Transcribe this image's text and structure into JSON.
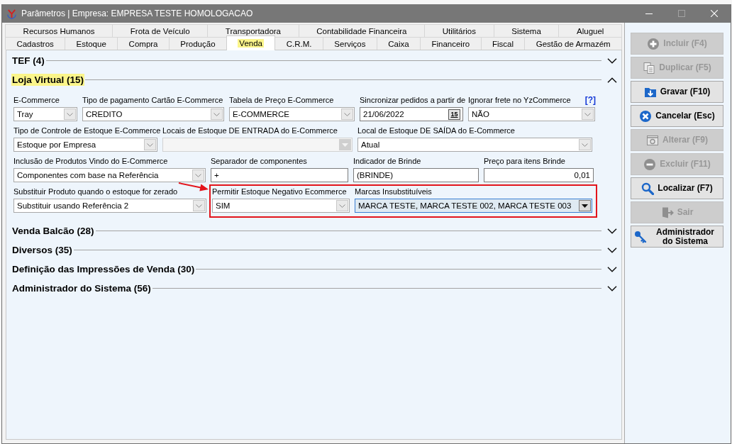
{
  "window": {
    "title": "Parâmetros | Empresa: EMPRESA TESTE HOMOLOGACAO"
  },
  "window_controls": [
    {
      "kind": "minimize",
      "disabled": false
    },
    {
      "kind": "maximize",
      "disabled": true
    },
    {
      "kind": "close",
      "disabled": false
    }
  ],
  "tab_rows": [
    [
      {
        "label": "Recursos Humanos",
        "selected": false,
        "highlighted": false
      },
      {
        "label": "Frota de Veículo",
        "selected": false,
        "highlighted": false
      },
      {
        "label": "Transportadora",
        "selected": false,
        "highlighted": false
      },
      {
        "label": "Contabilidade Financeira",
        "selected": false,
        "highlighted": false
      },
      {
        "label": "Utilitários",
        "selected": false,
        "highlighted": false
      },
      {
        "label": "Sistema",
        "selected": false,
        "highlighted": false
      },
      {
        "label": "Aluguel",
        "selected": false,
        "highlighted": false
      }
    ],
    [
      {
        "label": "Cadastros",
        "selected": false,
        "highlighted": false
      },
      {
        "label": "Estoque",
        "selected": false,
        "highlighted": false
      },
      {
        "label": "Compra",
        "selected": false,
        "highlighted": false
      },
      {
        "label": "Produção",
        "selected": false,
        "highlighted": false
      },
      {
        "label": "Venda",
        "selected": true,
        "highlighted": true
      },
      {
        "label": "C.R.M.",
        "selected": false,
        "highlighted": false
      },
      {
        "label": "Serviços",
        "selected": false,
        "highlighted": false
      },
      {
        "label": "Caixa",
        "selected": false,
        "highlighted": false
      },
      {
        "label": "Financeiro",
        "selected": false,
        "highlighted": false
      },
      {
        "label": "Fiscal",
        "selected": false,
        "highlighted": false
      },
      {
        "label": "Gestão de Armazém",
        "selected": false,
        "highlighted": false
      }
    ]
  ],
  "sections": [
    {
      "title": "TEF (4)",
      "expanded": false,
      "highlighted": false
    },
    {
      "title": "Loja Virtual (15)",
      "expanded": true,
      "highlighted": true,
      "form_rows": [
        {
          "pointer_arrow": false,
          "fields": [
            {
              "label": "E-Commerce",
              "kind": "combo",
              "value": "Tray",
              "disabled": false,
              "focused": false,
              "outlined": false
            },
            {
              "label": "Tipo de pagamento Cartão E-Commerce",
              "kind": "combo",
              "value": "CREDITO",
              "disabled": false,
              "focused": false,
              "outlined": false
            },
            {
              "label": "Tabela de Preço E-Commerce",
              "kind": "combo",
              "value": "E-COMMERCE",
              "disabled": false,
              "focused": false,
              "outlined": false
            },
            {
              "label": "Sincronizar pedidos a partir de",
              "kind": "date",
              "value": "21/06/2022",
              "calendar_label": "15",
              "disabled": false,
              "focused": false,
              "outlined": false
            },
            {
              "label": "Ignorar frete no YzCommerce",
              "help": "[?]",
              "kind": "combo",
              "value": "NÃO",
              "disabled": false,
              "focused": false,
              "outlined": false
            }
          ]
        },
        {
          "pointer_arrow": false,
          "fields": [
            {
              "label": "Tipo de Controle de Estoque E-Commerce",
              "kind": "combo",
              "value": "Estoque por Empresa",
              "disabled": false,
              "focused": false,
              "outlined": false
            },
            {
              "label": "Locais de Estoque DE ENTRADA do E-Commerce",
              "kind": "combo",
              "disabled": true,
              "focused": false,
              "outlined": false
            },
            {
              "label": "Local de Estoque DE SAÍDA do E-Commerce",
              "kind": "combo",
              "value": "Atual",
              "disabled": false,
              "focused": false,
              "outlined": false
            }
          ]
        },
        {
          "pointer_arrow": false,
          "fields": [
            {
              "label": "Inclusão de Produtos Vindo do E-Commerce",
              "kind": "combo",
              "value": "Componentes com base na Referência",
              "disabled": false,
              "focused": false,
              "outlined": false
            },
            {
              "label": "Separador de componentes",
              "kind": "text",
              "value": "+",
              "disabled": false,
              "focused": false,
              "outlined": false
            },
            {
              "label": "Indicador de Brinde",
              "kind": "text",
              "value": "(BRINDE)",
              "disabled": false,
              "focused": false,
              "outlined": false
            },
            {
              "label": "Preço para itens Brinde",
              "kind": "number",
              "value": "0,01",
              "disabled": false,
              "focused": false,
              "outlined": false
            }
          ]
        },
        {
          "pointer_arrow": true,
          "fields": [
            {
              "label": "Substituir Produto quando o estoque for zerado",
              "kind": "combo",
              "value": "Substituir usando Referência 2",
              "disabled": false,
              "focused": false,
              "outlined": false
            },
            {
              "label": "Permitir Estoque Negativo Ecommerce",
              "kind": "combo",
              "value": "SIM",
              "disabled": false,
              "focused": false,
              "outlined": true
            },
            {
              "label": "Marcas Insubstituíveis",
              "kind": "combo",
              "value": "MARCA TESTE, MARCA TESTE 002, MARCA TESTE 003",
              "disabled": false,
              "focused": true,
              "outlined": true
            }
          ]
        }
      ]
    },
    {
      "title": "Venda Balcão (28)",
      "expanded": false,
      "highlighted": false
    },
    {
      "title": "Diversos (35)",
      "expanded": false,
      "highlighted": false
    },
    {
      "title": "Definição das Impressões de Venda (30)",
      "expanded": false,
      "highlighted": false
    },
    {
      "title": "Administrador do Sistema (56)",
      "expanded": false,
      "highlighted": false
    }
  ],
  "actions": [
    {
      "label": "Incluir (F4)",
      "kind": "add",
      "disabled": true
    },
    {
      "label": "Duplicar (F5)",
      "kind": "duplicate",
      "disabled": true
    },
    {
      "label": "Gravar (F10)",
      "kind": "save",
      "disabled": false
    },
    {
      "label": "Cancelar (Esc)",
      "kind": "cancel",
      "disabled": false
    },
    {
      "label": "Alterar (F9)",
      "kind": "edit",
      "disabled": true
    },
    {
      "label": "Excluir (F11)",
      "kind": "delete",
      "disabled": true
    },
    {
      "label": "Localizar (F7)",
      "kind": "find",
      "disabled": false
    },
    {
      "label": "Sair",
      "kind": "exit",
      "disabled": true
    },
    {
      "label": "Administrador do Sistema",
      "kind": "admin",
      "disabled": false
    }
  ]
}
